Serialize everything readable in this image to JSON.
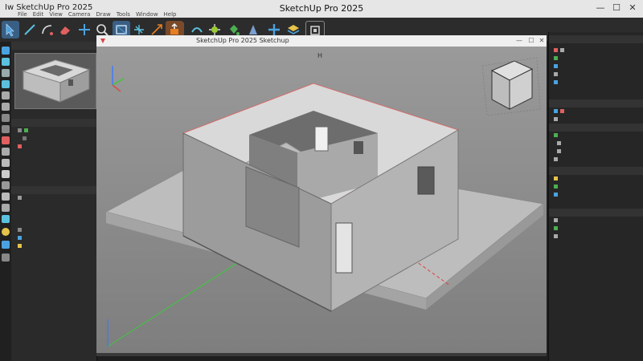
{
  "app": {
    "title": "SketchUp Pro 2025",
    "title_left": "Iw SketchUp Pro 2025",
    "menu": [
      "File",
      "Edit",
      "View",
      "Camera",
      "Draw",
      "Tools",
      "Window",
      "Help"
    ],
    "window_controls": [
      "—",
      "☐",
      "✕"
    ]
  },
  "toolbar": {
    "tools": [
      {
        "name": "select-icon",
        "color": "#4aa3e0"
      },
      {
        "name": "line-icon",
        "color": "#5bc0de"
      },
      {
        "name": "arc-icon",
        "color": "#e0e0e0"
      },
      {
        "name": "eraser-icon",
        "color": "#e06060"
      },
      {
        "name": "move-icon",
        "color": "#4aa3e0"
      },
      {
        "name": "zoom-icon",
        "color": "#e0e0e0"
      },
      {
        "name": "rectangle-icon",
        "color": "#4aa3e0"
      },
      {
        "name": "rotate-icon",
        "color": "#5bc0de"
      },
      {
        "name": "scale-icon",
        "color": "#e67e22"
      },
      {
        "name": "push-pull-icon",
        "color": "#e67e22"
      },
      {
        "name": "tape-measure-icon",
        "color": "#5bc0de"
      },
      {
        "name": "orbit-icon",
        "color": "#9acd32"
      },
      {
        "name": "paint-bucket-icon",
        "color": "#4caf50"
      },
      {
        "name": "text-icon",
        "color": "#7a9fd0"
      },
      {
        "name": "axes-icon",
        "color": "#4aa3e0"
      },
      {
        "name": "layers-icon",
        "color": "#e6c34a"
      },
      {
        "name": "section-icon",
        "color": "#e0e0e0"
      }
    ]
  },
  "viewport": {
    "tab_title": "SketchUp Pro 2025 Sketchup",
    "marker": "H"
  },
  "colors": {
    "accent": "#4aa3e0",
    "x_axis": "#e04040",
    "y_axis": "#3cc83c",
    "z_axis": "#3c78ff"
  }
}
